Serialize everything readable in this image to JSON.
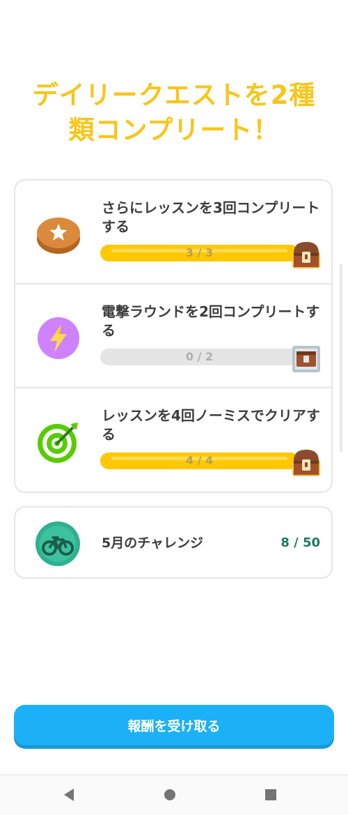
{
  "headline": "デイリークエストを2種類コンプリート！",
  "quests": [
    {
      "title": "さらにレッスンを3回コンプリートする",
      "progress_text": "3 / 3",
      "progress_fraction": 1.0,
      "icon": "star-coin-icon",
      "reward": "chest-icon"
    },
    {
      "title": "電撃ラウンドを2回コンプリートする",
      "progress_text": "0 / 2",
      "progress_fraction": 0.0,
      "icon": "lightning-icon",
      "reward": "chest-locked-icon"
    },
    {
      "title": "レッスンを4回ノーミスでクリアする",
      "progress_text": "4 / 4",
      "progress_fraction": 1.0,
      "icon": "target-icon",
      "reward": "chest-icon"
    }
  ],
  "challenge": {
    "label": "5月のチャレンジ",
    "count": "8 / 50",
    "icon": "bicycle-badge-icon"
  },
  "claim_button": "報酬を受け取る",
  "colors": {
    "accent": "#f7c61c",
    "progress": "#ffc800",
    "button": "#1cb0f6",
    "challenge_count": "#1f7a5f"
  }
}
